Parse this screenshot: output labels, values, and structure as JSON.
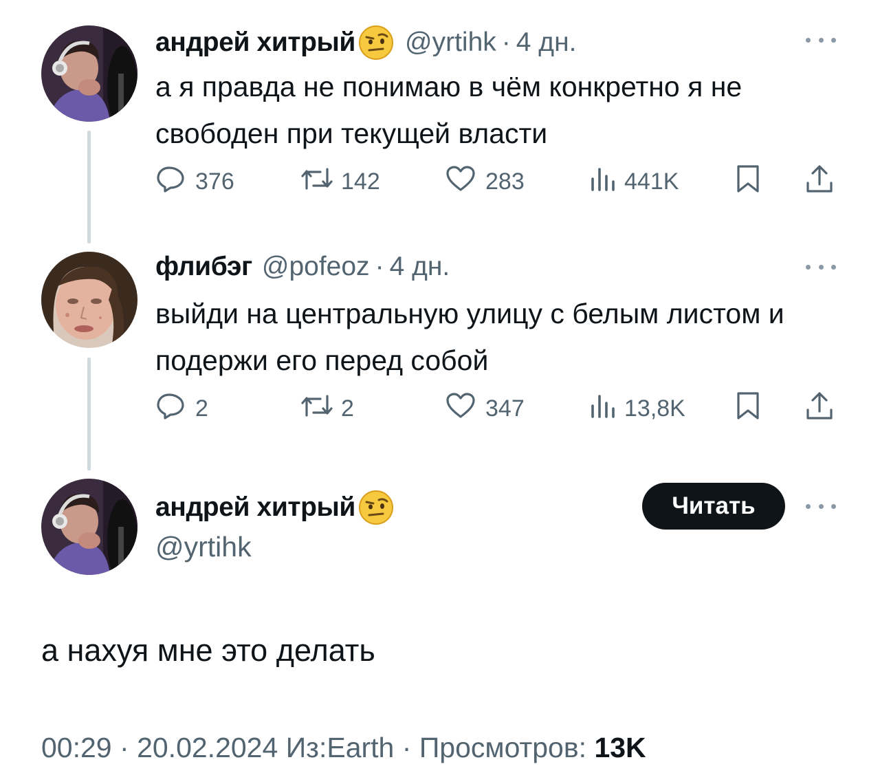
{
  "tweets": [
    {
      "name": "андрей хитрый",
      "emoji": "raised-eyebrow-face",
      "handle": "@yrtihk",
      "sep": "·",
      "time": "4 дн.",
      "text": "а я правда не понимаю в чём конкретно я не свободен при текущей власти",
      "replies": "376",
      "reposts": "142",
      "likes": "283",
      "views": "441K"
    },
    {
      "name": "флибэг",
      "handle": "@pofeoz",
      "sep": "·",
      "time": "4 дн.",
      "text": "выйди на центральную улицу с белым листом и подержи его перед собой",
      "replies": "2",
      "reposts": "2",
      "likes": "347",
      "views": "13,8K"
    }
  ],
  "main": {
    "name": "андрей хитрый",
    "emoji": "raised-eyebrow-face",
    "handle": "@yrtihk",
    "follow_label": "Читать",
    "text": "а нахуя мне это делать",
    "time": "00:29",
    "date": "20.02.2024",
    "source": "Из:Earth",
    "views_label": "Просмотров:",
    "views_value": "13K",
    "sep": "·"
  },
  "colors": {
    "text": "#0f1419",
    "muted": "#536471",
    "thread_line": "#cfd9de",
    "follow_bg": "#0f1419"
  },
  "icons": [
    "reply-icon",
    "repost-icon",
    "like-icon",
    "views-icon",
    "bookmark-icon",
    "share-icon",
    "more-icon",
    "emoji-face-icon"
  ]
}
